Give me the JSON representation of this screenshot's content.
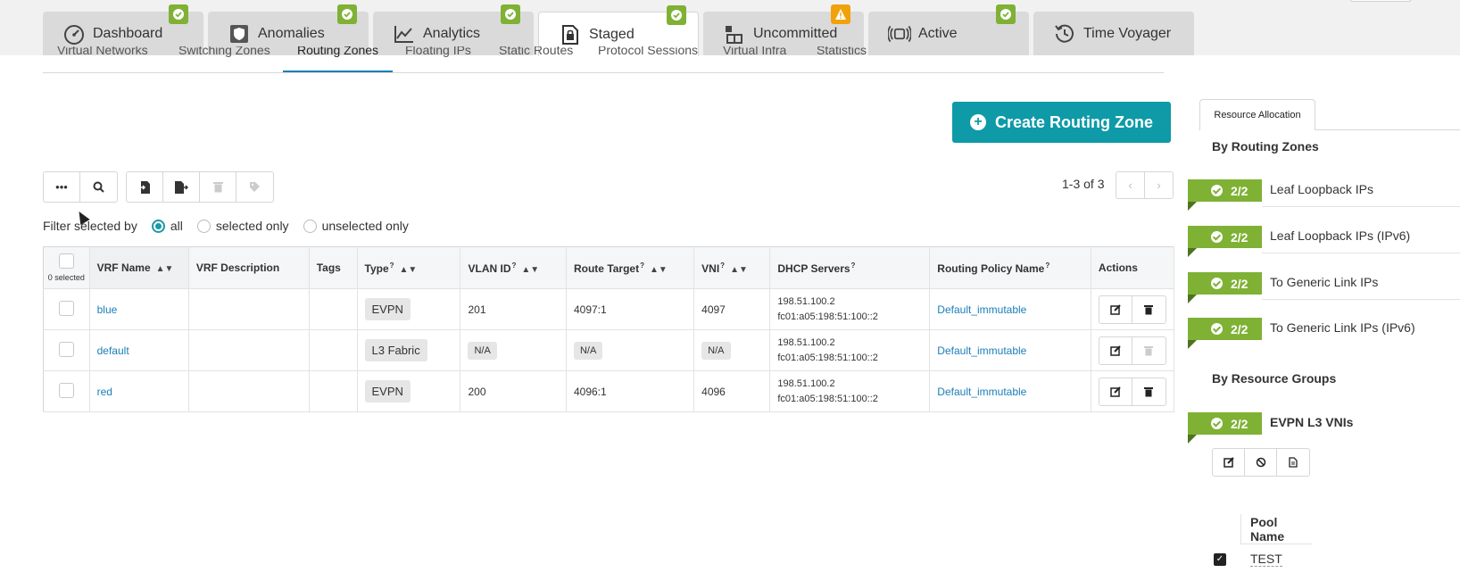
{
  "top_tabs": [
    {
      "label": "Dashboard",
      "icon": "dashboard-gauge-icon",
      "status": "ok"
    },
    {
      "label": "Anomalies",
      "icon": "shield-icon",
      "status": "ok"
    },
    {
      "label": "Analytics",
      "icon": "line-chart-icon",
      "status": "ok"
    },
    {
      "label": "Staged",
      "icon": "document-lock-icon",
      "status": "ok",
      "active": true
    },
    {
      "label": "Uncommitted",
      "icon": "boxes-icon",
      "status": "warning"
    },
    {
      "label": "Active",
      "icon": "broadcast-icon",
      "status": "ok"
    },
    {
      "label": "Time Voyager",
      "icon": "history-icon",
      "status": "none"
    }
  ],
  "sub_tabs": [
    {
      "label": "Virtual Networks"
    },
    {
      "label": "Switching Zones"
    },
    {
      "label": "Routing Zones",
      "active": true
    },
    {
      "label": "Floating IPs"
    },
    {
      "label": "Static Routes"
    },
    {
      "label": "Protocol Sessions"
    },
    {
      "label": "Virtual Infra"
    },
    {
      "label": "Statistics"
    }
  ],
  "create_button": {
    "label": "Create Routing Zone"
  },
  "pagination": {
    "text": "1-3 of 3"
  },
  "filter": {
    "label": "Filter selected by",
    "options": [
      "all",
      "selected only",
      "unselected only"
    ],
    "selected": "all"
  },
  "table": {
    "selected_count": "0 selected",
    "columns": [
      "VRF Name",
      "VRF Description",
      "Tags",
      "Type",
      "VLAN ID",
      "Route Target",
      "VNI",
      "DHCP Servers",
      "Routing Policy Name",
      "Actions"
    ],
    "rows": [
      {
        "vrf_name": "blue",
        "description": "",
        "tags": "",
        "type": "EVPN",
        "vlan_id": "201",
        "route_target": "4097:1",
        "vni": "4097",
        "dhcp1": "198.51.100.2",
        "dhcp2": "fc01:a05:198:51:100::2",
        "policy": "Default_immutable"
      },
      {
        "vrf_name": "default",
        "description": "",
        "tags": "",
        "type": "L3 Fabric",
        "vlan_id": "N/A",
        "route_target": "N/A",
        "vni": "N/A",
        "dhcp1": "198.51.100.2",
        "dhcp2": "fc01:a05:198:51:100::2",
        "policy": "Default_immutable"
      },
      {
        "vrf_name": "red",
        "description": "",
        "tags": "",
        "type": "EVPN",
        "vlan_id": "200",
        "route_target": "4096:1",
        "vni": "4096",
        "dhcp1": "198.51.100.2",
        "dhcp2": "fc01:a05:198:51:100::2",
        "policy": "Default_immutable"
      }
    ]
  },
  "right_panel": {
    "tab": "Resource Allocation",
    "by_routing_zones": "By Routing Zones",
    "routing_zone_resources": [
      {
        "count": "2/2",
        "label": "Leaf Loopback IPs"
      },
      {
        "count": "2/2",
        "label": "Leaf Loopback IPs (IPv6)"
      },
      {
        "count": "2/2",
        "label": "To Generic Link IPs"
      },
      {
        "count": "2/2",
        "label": "To Generic Link IPs (IPv6)"
      }
    ],
    "by_resource_groups": "By Resource Groups",
    "resource_group": {
      "count": "2/2",
      "label": "EVPN L3 VNIs"
    },
    "pool_header": "Pool Name",
    "pool_value": "TEST"
  },
  "colors": {
    "accent": "#0e9aa7",
    "ok_badge": "#7fb135",
    "warning_badge": "#f0a20a",
    "link": "#1a7eb8"
  }
}
